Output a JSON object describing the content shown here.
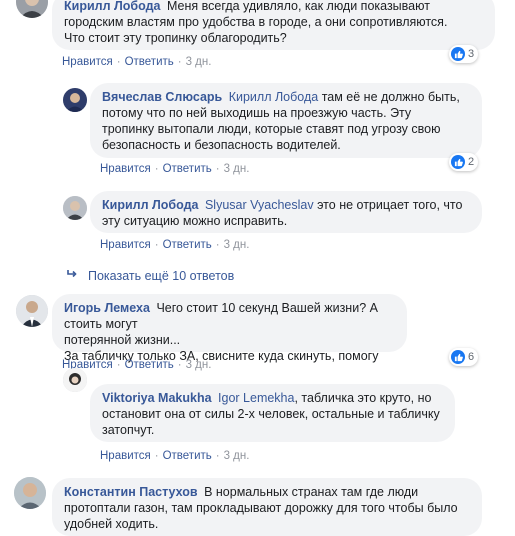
{
  "colors": {
    "link": "#385898",
    "bubble": "#f2f3f5",
    "like_blue": "#1877f2",
    "meta_gray": "#90949c"
  },
  "comments": [
    {
      "author": "Кирилл Лобода",
      "lines": [
        "Меня всегда удивляло, как люди показывают",
        "городским властям про удобства в городе, а они сопротивляются.",
        "Что стоит эту тропинку облагородить?"
      ],
      "like": "Нравится",
      "reply": "Ответить",
      "time": "3 дн.",
      "reactions": "3"
    },
    {
      "author": "Вячеслав Слюсарь",
      "mention": "Кирилл Лобода",
      "lines": [
        "там её не должно быть,",
        "потому что по ней выходишь на проезжую часть. Эту",
        "тропинку вытопали люди, которые ставят под угрозу свою",
        "безопасность и безопасность водителей."
      ],
      "like": "Нравится",
      "reply": "Ответить",
      "time": "3 дн.",
      "reactions": "2"
    },
    {
      "author": "Кирилл Лобода",
      "mention": "Slyusar Vyacheslav",
      "lines": [
        "это не отрицает того, что",
        "эту ситуацию можно исправить."
      ],
      "like": "Нравится",
      "reply": "Ответить",
      "time": "3 дн."
    },
    {
      "author": "Игорь Лемеха",
      "lines": [
        "Чего стоит 10 секунд Вашей жизни? А стоить могут",
        "потерянной жизни...",
        "За табличку только ЗА, свисните куда скинуть, помогу"
      ],
      "like": "Нравится",
      "reply": "Ответить",
      "time": "3 дн.",
      "reactions": "6"
    },
    {
      "author": "Viktoriya Makukha",
      "mention": "Igor Lemekha",
      "lines": [
        ", табличка это круто, но",
        "остановит она от силы 2-х человек, остальные и табличку",
        "затопчут."
      ],
      "like": "Нравится",
      "reply": "Ответить",
      "time": "3 дн."
    },
    {
      "author": "Константин Пастухов",
      "lines": [
        "В нормальных странах там где люди",
        "протоптали газон, там прокладывают дорожку для того чтобы было",
        "удобней ходить."
      ]
    }
  ],
  "more_replies": "Показать ещё 10 ответов"
}
